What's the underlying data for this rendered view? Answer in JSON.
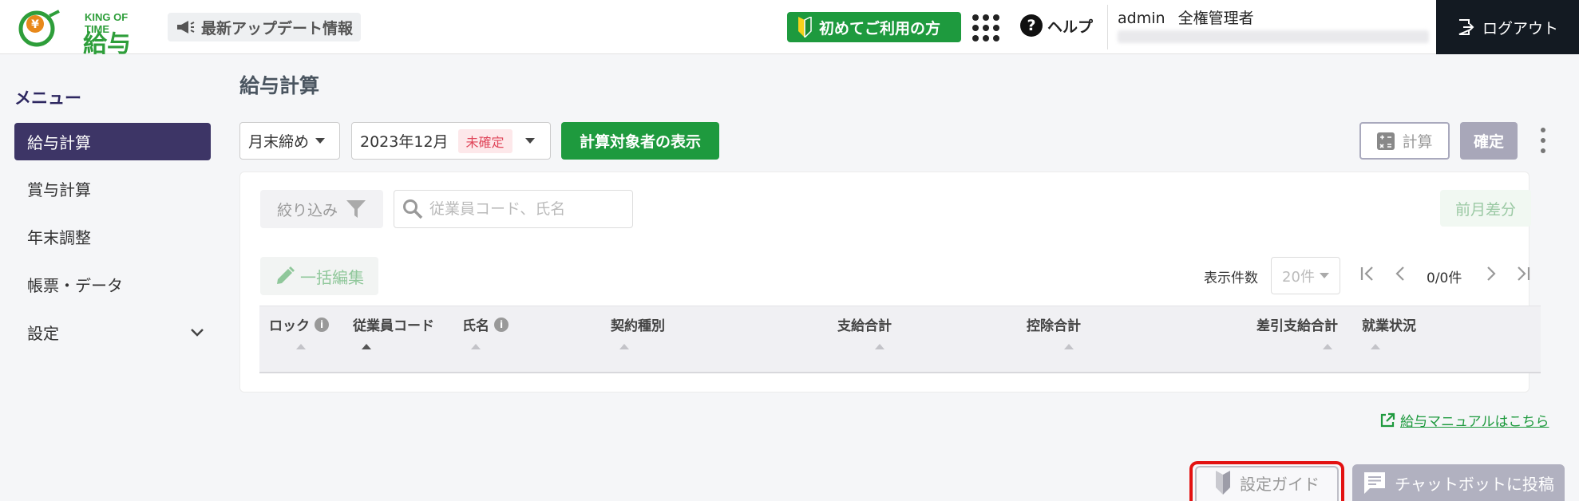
{
  "header": {
    "logo_sub": "KING OF TIME",
    "logo_main": "給与",
    "news_label": "最新アップデート情報",
    "beginner_label": "初めてご利用の方",
    "help_label": "ヘルプ",
    "user_name": "admin",
    "user_role": "全権管理者",
    "logout_label": "ログアウト"
  },
  "sidebar": {
    "title": "メニュー",
    "items": [
      {
        "label": "給与計算"
      },
      {
        "label": "賞与計算"
      },
      {
        "label": "年末調整"
      },
      {
        "label": "帳票・データ"
      },
      {
        "label": "設定"
      }
    ]
  },
  "main": {
    "title": "給与計算",
    "closing_select": "月末締め",
    "period_select": "2023年12月",
    "period_status": "未確定",
    "show_button": "計算対象者の表示",
    "calc_button": "計算",
    "confirm_button": "確定",
    "filter_button": "絞り込み",
    "search_placeholder": "従業員コード、氏名",
    "prev_diff_button": "前月差分",
    "bulk_edit_button": "一括編集",
    "per_page_label": "表示件数",
    "per_page_value": "20件",
    "page_count": "0/0件",
    "columns": [
      "ロック",
      "従業員コード",
      "氏名",
      "契約種別",
      "支給合計",
      "控除合計",
      "差引支給合計",
      "就業状況"
    ],
    "manual_link": "給与マニュアルはこちら"
  },
  "footer": {
    "guide_button": "設定ガイド",
    "chatbot_button": "チャットボットに投稿"
  },
  "colors": {
    "brand_green": "#1e9a3e",
    "nav_active": "#3d3566",
    "logout_bg": "#131a22",
    "highlight_red": "#e31212"
  }
}
